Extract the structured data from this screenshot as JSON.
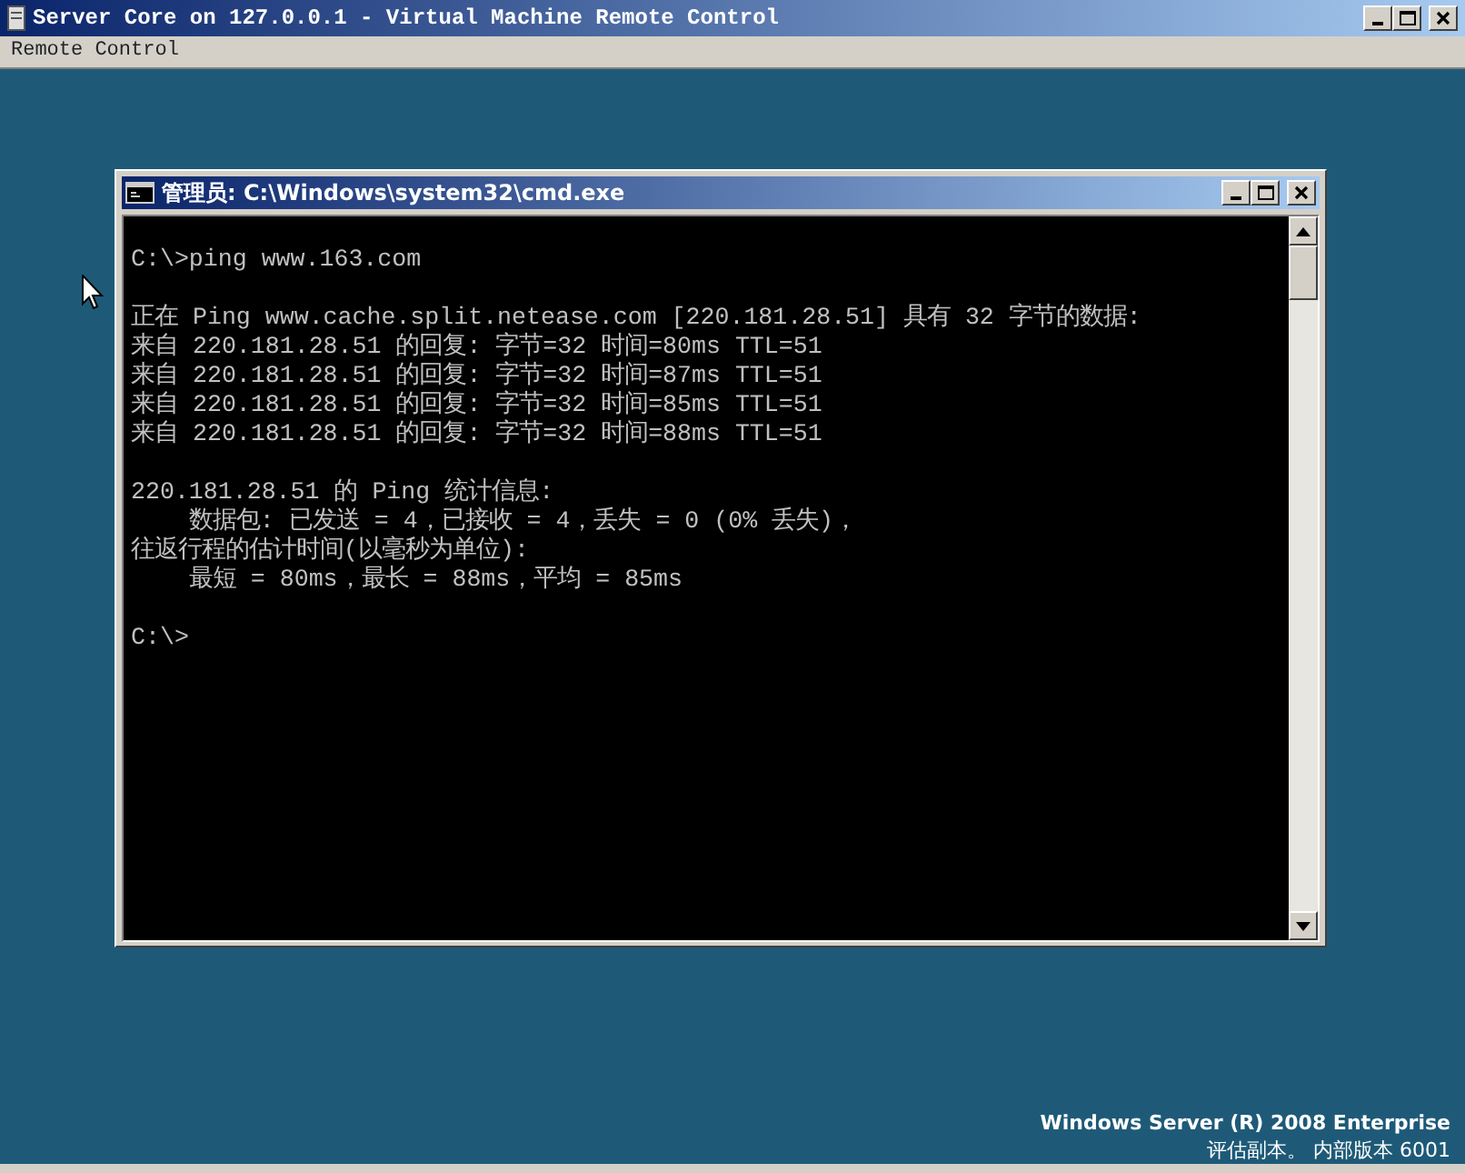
{
  "window": {
    "title": "Server Core on 127.0.0.1 - Virtual Machine Remote Control"
  },
  "menu": [
    "Remote Control"
  ],
  "console": {
    "title": "管理员: C:\\Windows\\system32\\cmd.exe",
    "blocks": [
      [
        "C:\\>ping www.163.com"
      ],
      [
        "正在 Ping www.cache.split.netease.com [220.181.28.51] 具有 32 字节的数据:",
        "来自 220.181.28.51 的回复: 字节=32 时间=80ms TTL=51",
        "来自 220.181.28.51 的回复: 字节=32 时间=87ms TTL=51",
        "来自 220.181.28.51 的回复: 字节=32 时间=85ms TTL=51",
        "来自 220.181.28.51 的回复: 字节=32 时间=88ms TTL=51"
      ],
      [
        "220.181.28.51 的 Ping 统计信息:",
        "    数据包: 已发送 = 4，已接收 = 4，丢失 = 0 (0% 丢失)，",
        "往返行程的估计时间(以毫秒为单位):",
        "    最短 = 80ms，最长 = 88ms，平均 = 85ms"
      ],
      [
        "C:\\>"
      ]
    ]
  },
  "watermark": {
    "product": "Windows Server (R) 2008 Enterprise",
    "build": "评估副本。 内部版本 6001"
  }
}
